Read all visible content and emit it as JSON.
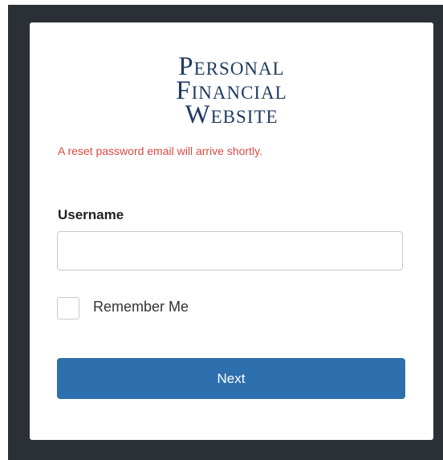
{
  "logo": {
    "line1": "Personal",
    "line2": "Financial",
    "line3": "Website"
  },
  "message": "A reset password email will arrive shortly.",
  "form": {
    "username_label": "Username",
    "username_value": "",
    "remember_label": "Remember Me",
    "remember_checked": false,
    "next_label": "Next"
  },
  "colors": {
    "frame": "#2b2f36",
    "brand": "#1e3a5f",
    "error": "#d94a43",
    "button": "#2e70ad"
  }
}
